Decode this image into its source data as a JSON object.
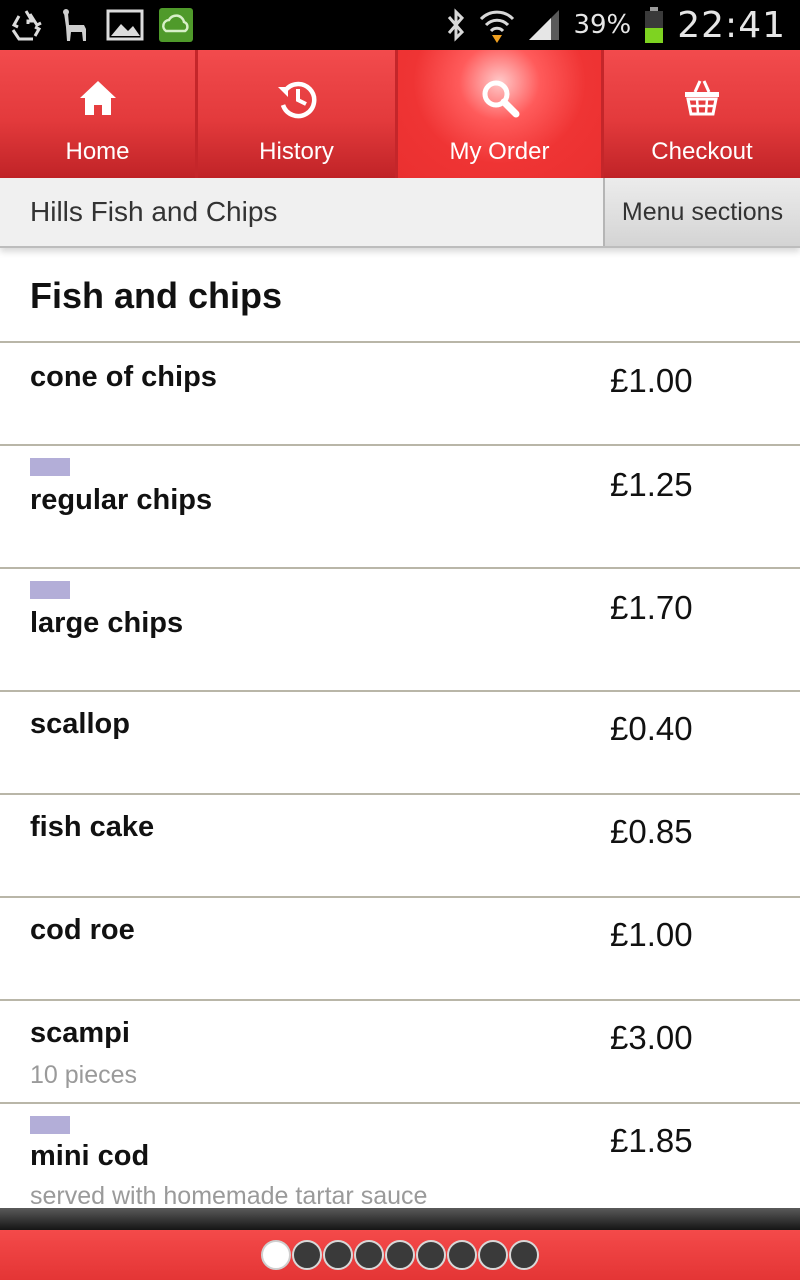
{
  "status_bar": {
    "battery_percent": "39%",
    "time": "22:41",
    "icons": [
      "recycle-icon",
      "alpaca-icon",
      "gallery-icon",
      "weather-app-icon",
      "bluetooth-icon",
      "wifi-icon",
      "signal-icon",
      "battery-icon"
    ]
  },
  "nav": {
    "tabs": [
      {
        "label": "Home",
        "icon": "home-icon",
        "active": false
      },
      {
        "label": "History",
        "icon": "history-icon",
        "active": false
      },
      {
        "label": "My Order",
        "icon": "search-icon",
        "active": true
      },
      {
        "label": "Checkout",
        "icon": "basket-icon",
        "active": false
      }
    ]
  },
  "restaurant": {
    "name": "Hills Fish and Chips",
    "menu_sections_label": "Menu sections"
  },
  "section": {
    "title": "Fish and chips",
    "items": [
      {
        "name": "cone of chips",
        "price": "£1.00",
        "description": "",
        "swatch": false
      },
      {
        "name": "regular chips",
        "price": "£1.25",
        "description": "",
        "swatch": true
      },
      {
        "name": "large chips",
        "price": "£1.70",
        "description": "",
        "swatch": true
      },
      {
        "name": "scallop",
        "price": "£0.40",
        "description": "",
        "swatch": false
      },
      {
        "name": "fish cake",
        "price": "£0.85",
        "description": "",
        "swatch": false
      },
      {
        "name": "cod roe",
        "price": "£1.00",
        "description": "",
        "swatch": false
      },
      {
        "name": "scampi",
        "price": "£3.00",
        "description": "10 pieces",
        "swatch": false
      },
      {
        "name": "mini cod",
        "price": "£1.85",
        "description": "served with homemade tartar sauce",
        "swatch": true
      }
    ]
  },
  "pager": {
    "page_count": 9,
    "current_page": 1
  },
  "colors": {
    "accent_red": "#e83535",
    "swatch": "#b3aed8"
  }
}
